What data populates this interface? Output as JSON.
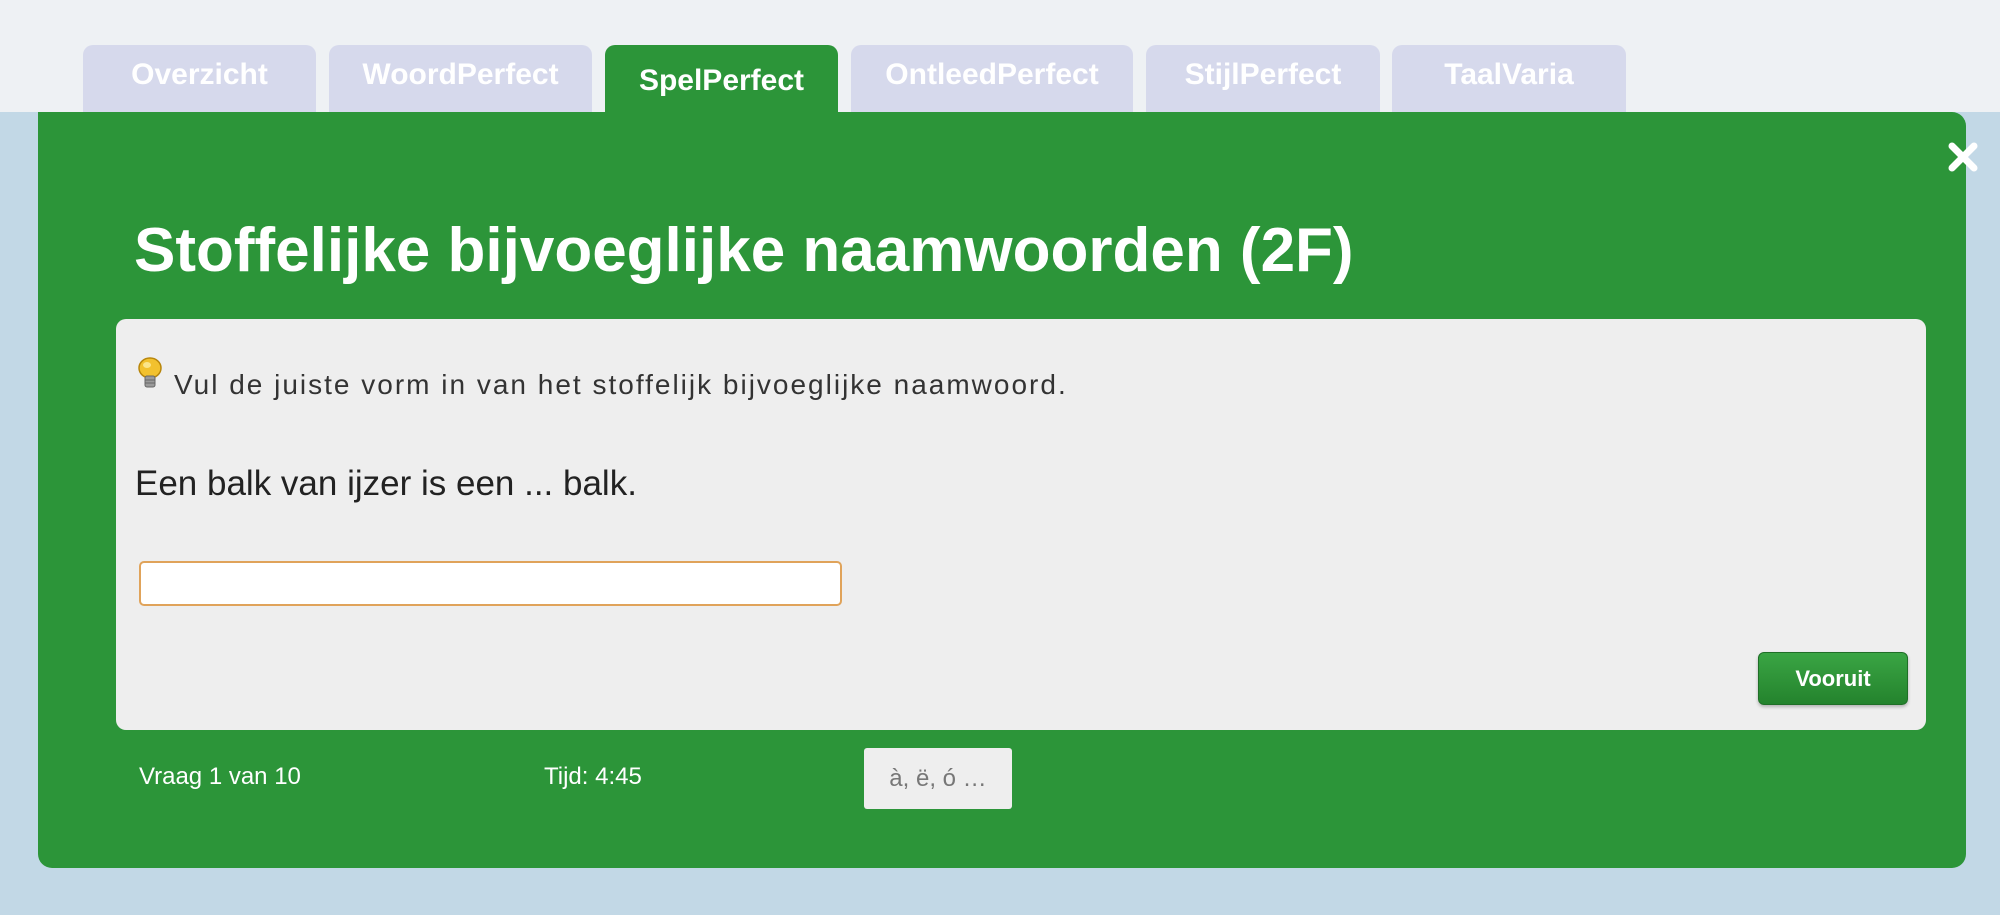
{
  "tabs": [
    {
      "label": "Overzicht"
    },
    {
      "label": "WoordPerfect"
    },
    {
      "label": "SpelPerfect",
      "active": true
    },
    {
      "label": "OntleedPerfect"
    },
    {
      "label": "StijlPerfect"
    },
    {
      "label": "TaalVaria"
    }
  ],
  "panel": {
    "title": "Stoffelijke bijvoeglijke naamwoorden (2F)",
    "close_icon": "close-icon"
  },
  "exercise": {
    "hint_icon": "lightbulb-icon",
    "instruction": "Vul de juiste vorm in van het stoffelijk bijvoeglijke naamwoord.",
    "question": "Een balk van ijzer is een ... balk.",
    "answer_value": "",
    "next_label": "Vooruit"
  },
  "footer": {
    "progress": "Vraag 1 van 10",
    "timer": "Tijd: 4:45",
    "special_chars_label": "à, ë, ó …"
  },
  "colors": {
    "accent": "#2c9539",
    "tab_inactive": "#d6d9ec",
    "background": "#c2d8e6",
    "input_border": "#e0a35a"
  }
}
